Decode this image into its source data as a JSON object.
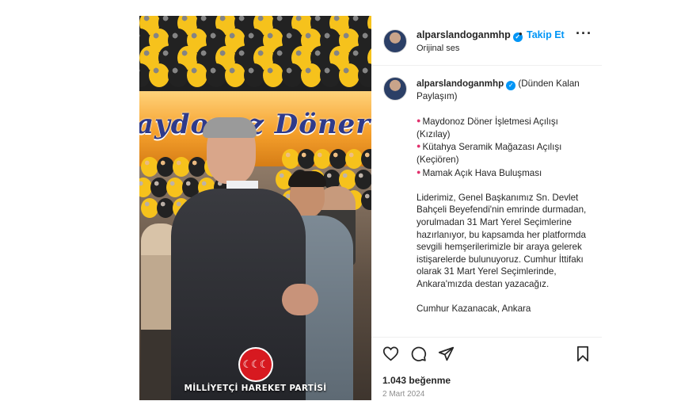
{
  "header": {
    "username": "alparslandoganmhp",
    "separator": "•",
    "follow_label": "Takip Et",
    "audio_label": "Orijinal ses",
    "more_icon": "more-horizontal-icon"
  },
  "caption": {
    "username": "alparslandoganmhp",
    "title": "(Dünden Kalan Paylaşım)",
    "bullets": [
      "Maydonoz Döner İşletmesi Açılışı (Kızılay)",
      "Kütahya Seramik Mağazası Açılışı (Keçiören)",
      "Mamak Açık Hava Buluşması"
    ],
    "body": "Liderimiz, Genel Başkanımız Sn. Devlet Bahçeli Beyefendi'nin emrinde durmadan, yorulmadan 31 Mart Yerel Seçimlerine hazırlanıyor, bu kapsamda her platformda sevgili hemşerilerimizle bir araya gelerek istişarelerde bulunuyoruz. Cumhur İttifakı olarak 31 Mart Yerel Seçimlerinde, Ankara'mızda destan yazacağız.",
    "closing": "Cumhur Kazanacak, Ankara"
  },
  "media": {
    "store_sign": "aydonoz Döner",
    "logo_text": "☾☾☾",
    "party_name": "MİLLİYETÇİ HAREKET PARTİSİ"
  },
  "actions": {
    "icons": [
      "heart-icon",
      "comment-icon",
      "share-icon",
      "bookmark-icon"
    ],
    "likes": "1.043 beğenme",
    "date": "2 Mart 2024"
  },
  "colors": {
    "accent": "#0095f6",
    "text": "#262626",
    "muted": "#8e8e8e",
    "brand_red": "#d71920",
    "balloon_yellow": "#f6c21c",
    "balloon_black": "#222222"
  }
}
